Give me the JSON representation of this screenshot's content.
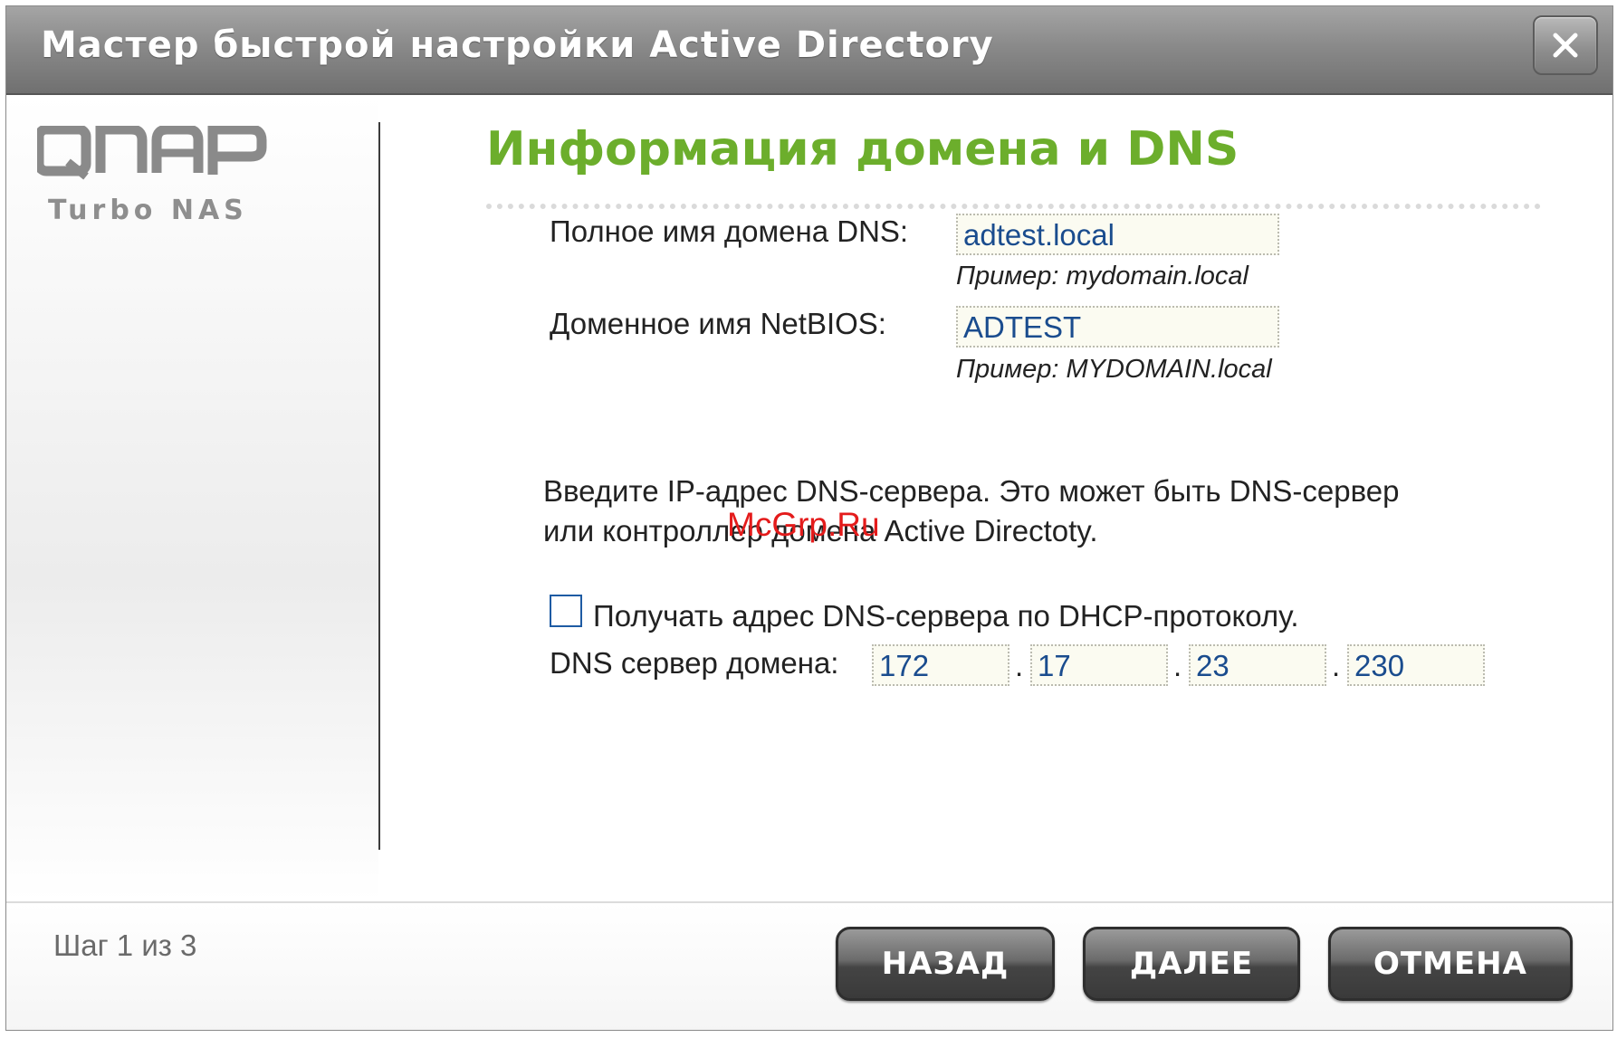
{
  "window": {
    "title": "Мастер быстрой настройки Active Directory",
    "close_icon": "close-icon"
  },
  "sidebar": {
    "logo_text": "QNAP",
    "logo_subtext": "Turbo NAS"
  },
  "main": {
    "heading": "Информация домена и DNS",
    "dns_domain_label": "Полное имя домена DNS:",
    "dns_domain_value": "adtest.local",
    "dns_domain_example": "Пример: mydomain.local",
    "netbios_label": "Доменное имя NetBIOS:",
    "netbios_value": "ADTEST",
    "netbios_example": "Пример: MYDOMAIN.local",
    "description_line1": "Введите IP-адрес DNS-сервера. Это может быть DNS-сервер",
    "description_line2": "или контроллер домена Active Directoty.",
    "dhcp_checkbox_label": "Получать адрес DNS-сервера по DHCP-протоколу.",
    "dhcp_checked": false,
    "dns_server_label": "DNS сервер домена:",
    "dns_ip": [
      "172",
      "17",
      "23",
      "230"
    ],
    "watermark": "McGrp.Ru"
  },
  "footer": {
    "step_text": "Шаг 1 из 3",
    "back_label": "НАЗАД",
    "next_label": "ДАЛЕЕ",
    "cancel_label": "ОТМЕНА"
  },
  "colors": {
    "heading_green": "#6cae2c",
    "input_text_blue": "#1a4c8e",
    "watermark_red": "#e41b1b"
  }
}
